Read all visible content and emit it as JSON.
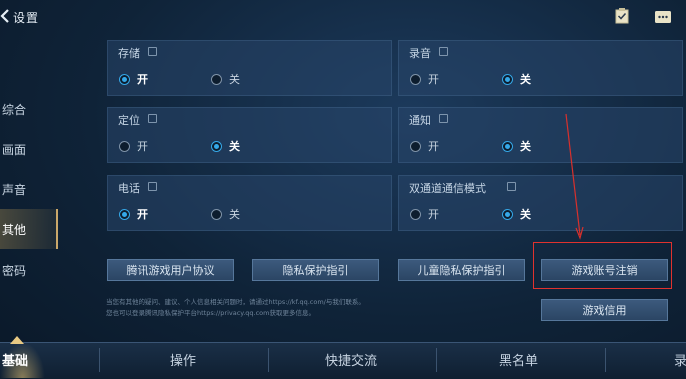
{
  "header": {
    "title": "设置"
  },
  "nav": [
    {
      "label": "综合"
    },
    {
      "label": "画面"
    },
    {
      "label": "声音"
    },
    {
      "label": "其他",
      "active": true
    },
    {
      "label": "密码"
    }
  ],
  "panels": [
    {
      "label": "存储",
      "options": [
        "开",
        "关"
      ],
      "selected": "开"
    },
    {
      "label": "录音",
      "options": [
        "开",
        "关"
      ],
      "selected": "关"
    },
    {
      "label": "定位",
      "options": [
        "开",
        "关"
      ],
      "selected": "关"
    },
    {
      "label": "通知",
      "options": [
        "开",
        "关"
      ],
      "selected": "关"
    },
    {
      "label": "电话",
      "options": [
        "开",
        "关"
      ],
      "selected": "开"
    },
    {
      "label": "双通道通信模式",
      "options": [
        "开",
        "关"
      ],
      "selected": "关"
    }
  ],
  "buttons": {
    "user_agreement": "腾讯游戏用户协议",
    "privacy": "隐私保护指引",
    "child_privacy": "儿童隐私保护指引",
    "account_cancel": "游戏账号注销",
    "credit": "游戏信用"
  },
  "notes": {
    "line1": "当您有其他的疑问、建议、个人信息相关问题时，请通过https://kf.qq.com/与我们联系。",
    "line2": "您也可以登录腾讯隐私保护平台https://privacy.qq.com获取更多信息。"
  },
  "bottom_tabs": [
    {
      "label": "基础",
      "active": true
    },
    {
      "label": "操作"
    },
    {
      "label": "快捷交流"
    },
    {
      "label": "黑名单"
    },
    {
      "label": "录"
    }
  ],
  "colors": {
    "radio_on": "#35a8e8",
    "highlight_box": "#e0322e",
    "active_tab": "#caa86a"
  }
}
